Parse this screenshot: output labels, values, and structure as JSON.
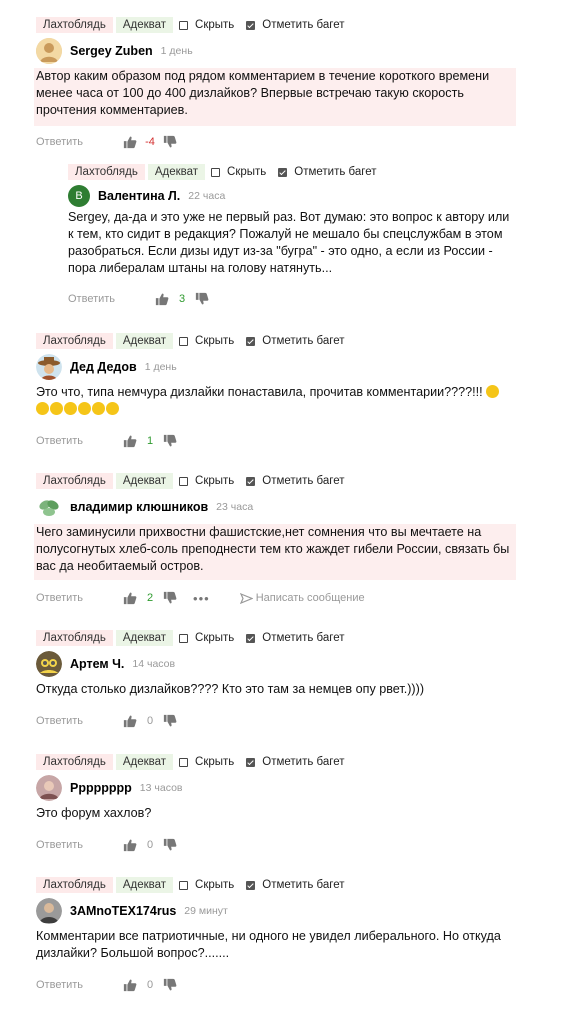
{
  "toolbar": {
    "tag_lah": "Лахтоблядь",
    "tag_adekvat": "Адекват",
    "hide": "Скрыть",
    "mark_bug": "Отметить багет",
    "hide_checked": false,
    "mark_checked": true
  },
  "actions": {
    "reply": "Ответить",
    "write_message": "Написать сообщение",
    "more": "•••"
  },
  "comments": [
    {
      "author": "Sergey Zuben",
      "time": "1 день",
      "text": "Автор каким образом под рядом комментарием в течение короткого времени менее часа от 100 до 400 дизлайков? Впервые встречаю такую скорость прочтения комментариев.",
      "score": "-4",
      "avatar_icon": "face-avatar-icon",
      "reply": {
        "author": "Валентина Л.",
        "avatar_letter": "В",
        "time": "22 часа",
        "text": "Sergey, да-да и это уже не первый раз. Вот думаю: это вопрос к автору или к тем, кто сидит в редакция? Пожалуй не мешало бы спецслужбам в этом разобраться. Если дизы идут из-за \"бугра\" - это одно, а если из России - пора либералам штаны на голову натянуть...",
        "score": "3"
      }
    },
    {
      "author": "Дед Дедов",
      "time": "1 день",
      "text": "Это что, типа немчура дизлайки понаставила, прочитав комментарии????!!!",
      "emoji": "😂",
      "score": "1",
      "avatar_icon": "cowboy-avatar-icon"
    },
    {
      "author": "владимир клюшников",
      "time": "23 часа",
      "text": "Чего заминусили прихвостни фашистские,нет сомнения что вы мечтаете на полусогнутых хлеб-соль преподнести тем кто жаждет гибели России, связать бы вас да необитаемый остров.",
      "score": "2",
      "avatar_icon": "leaves-avatar-icon"
    },
    {
      "author": "Артем Ч.",
      "time": "14 часов",
      "text": "Откуда столько дизлайков???? Кто это там за немцев опу рвет.))))",
      "score": "0",
      "avatar_icon": "minion-avatar-icon"
    },
    {
      "author": "Рррррррр",
      "time": "13 часов",
      "text": "Это форум хахлов?",
      "score": "0",
      "avatar_icon": "photo-avatar-icon"
    },
    {
      "author": "3AMnoTEX174rus",
      "time": "29 минут",
      "text": "Комментарии все патриотичные, ни одного не увидел либерального. Но откуда дизлайки? Большой вопрос?.......",
      "score": "0",
      "avatar_icon": "person-avatar-icon"
    }
  ],
  "colors": {
    "tag_lah_bg": "#fdeaea",
    "tag_adekvat_bg": "#ebf5e6",
    "highlight_bg": "#fdeeee",
    "negative": "#d32f2f",
    "positive": "#2e9a2e"
  }
}
